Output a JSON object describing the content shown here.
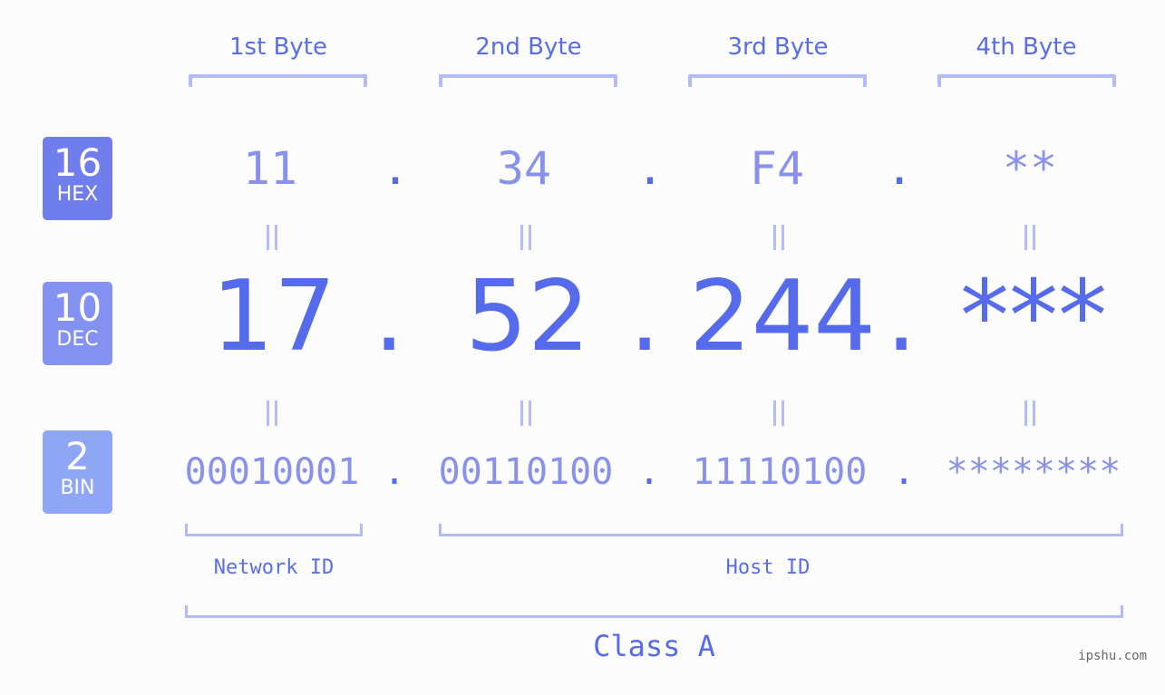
{
  "headers": [
    "1st Byte",
    "2nd Byte",
    "3rd Byte",
    "4th Byte"
  ],
  "badges": {
    "hex": {
      "num": "16",
      "label": "HEX",
      "color": "#6f7ded"
    },
    "dec": {
      "num": "10",
      "label": "DEC",
      "color": "#8391f1"
    },
    "bin": {
      "num": "2",
      "label": "BIN",
      "color": "#8fa5f6"
    }
  },
  "hex": [
    "11",
    "34",
    "F4",
    "**"
  ],
  "dec": [
    "17",
    "52",
    "244",
    "***"
  ],
  "bin": [
    "00010001",
    "00110100",
    "11110100",
    "********"
  ],
  "separator": ".",
  "network_label": "Network ID",
  "host_label": "Host ID",
  "class_label": "Class A",
  "watermark": "ipshu.com",
  "colors": {
    "primary": "#566beb",
    "light": "#8891ee",
    "bracket": "#b2baf7"
  }
}
